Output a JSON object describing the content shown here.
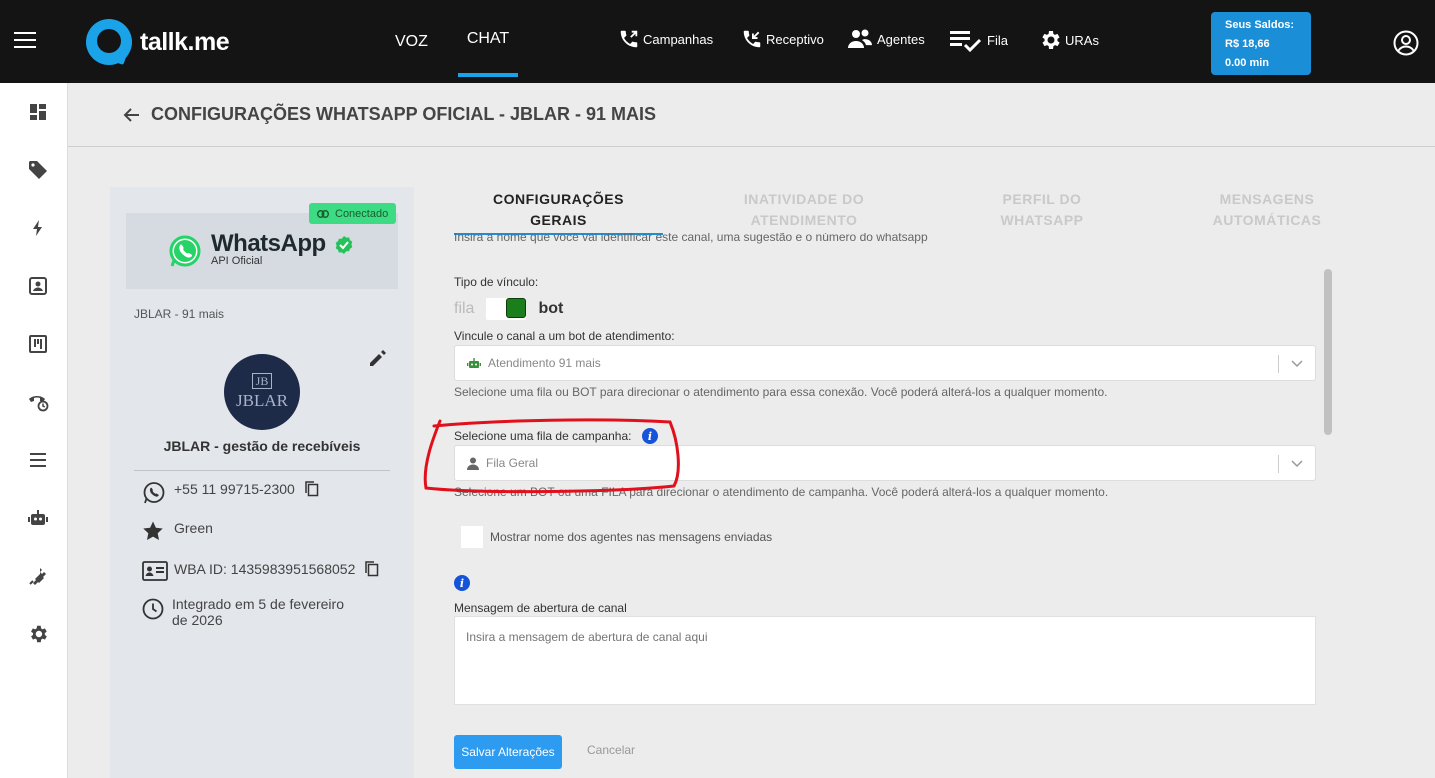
{
  "topbar": {
    "logo_text": "tallk.me",
    "nav_voz": "VOZ",
    "nav_chat": "CHAT",
    "items": [
      {
        "label": "Campanhas",
        "icon": "phone-outgoing-icon"
      },
      {
        "label": "Receptivo",
        "icon": "phone-incoming-icon"
      },
      {
        "label": "Agentes",
        "icon": "agents-icon"
      },
      {
        "label": "Fila",
        "icon": "queue-list-icon"
      },
      {
        "label": "URAs",
        "icon": "gear-icon"
      }
    ],
    "saldo_title": "Seus Saldos:",
    "saldo_money": "R$ 18,66",
    "saldo_minutes": "0.00 min"
  },
  "colors": {
    "topbar": "#141414",
    "accent": "#1a8fd8",
    "connected": "#3ddc84",
    "annotation": "#e0111c"
  },
  "page": {
    "title": "CONFIGURAÇÕES WHATSAPP OFICIAL - JBLAR - 91 MAIS"
  },
  "card": {
    "status": "Conectado",
    "brand": "WhatsApp",
    "api": "API Oficial",
    "channel_name": "JBLAR - 91 mais",
    "avatar_mark": "JB",
    "avatar_text": "JBLAR",
    "company": "JBLAR - gestão de recebíveis",
    "phone": "+55 11 99715-2300",
    "tier": "Green",
    "wba": "WBA ID: 1435983951568052",
    "integrated": "Integrado em 5 de fevereiro de 2026"
  },
  "tabs": [
    {
      "line1": "CONFIGURAÇÕES",
      "line2": "GERAIS"
    },
    {
      "line1": "INATIVIDADE DO",
      "line2": "ATENDIMENTO"
    },
    {
      "line1": "PERFIL DO",
      "line2": "WHATSAPP"
    },
    {
      "line1": "MENSAGENS",
      "line2": "AUTOMÁTICAS"
    }
  ],
  "form": {
    "hint_top": "Insira a nome que você vai identificar este canal, uma sugestão e o número do whatsapp",
    "tipo_label": "Tipo de vínculo:",
    "toggle_off": "fila",
    "toggle_on": "bot",
    "bot_label": "Vincule o canal a um bot de atendimento:",
    "bot_value": "Atendimento 91 mais",
    "bot_helper": "Selecione uma fila ou BOT para direcionar o atendimento para essa conexão. Você poderá alterá-los a qualquer momento.",
    "campaign_label": "Selecione uma fila de campanha:",
    "campaign_value": "Fila Geral",
    "campaign_helper": "Selecione um BOT ou uma FILA para direcionar o atendimento de campanha. Você poderá alterá-los a qualquer momento.",
    "checkbox_label": "Mostrar nome dos agentes nas mensagens enviadas",
    "opening_label": "Mensagem de abertura de canal",
    "opening_placeholder": "Insira a mensagem de abertura de canal aqui",
    "save": "Salvar Alterações",
    "cancel": "Cancelar"
  }
}
